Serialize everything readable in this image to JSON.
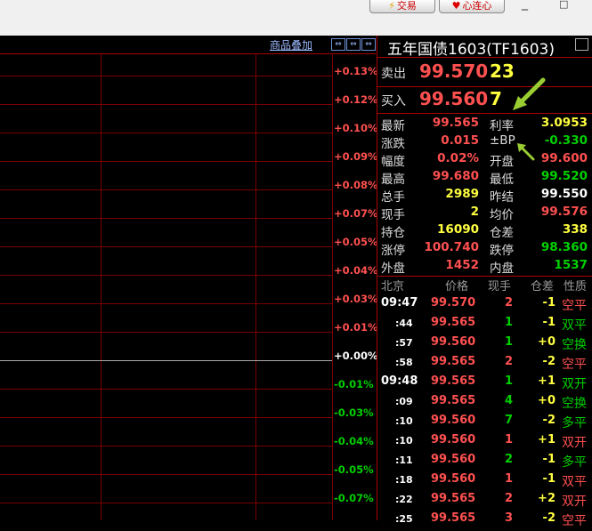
{
  "toolbar": {
    "trade_label": "交易",
    "xinlian_label": "心连心",
    "window_controls": [
      "_",
      "□"
    ]
  },
  "chart": {
    "overlay_link": "商品叠加",
    "zoom_buttons": [
      "⇔",
      "⇔",
      "⇔"
    ],
    "price_labels": [
      "+0.13%",
      "+0.12%",
      "+0.10%",
      "+0.09%",
      "+0.08%",
      "+0.07%",
      "+0.05%",
      "+0.04%",
      "+0.03%",
      "+0.01%",
      "+0.00%",
      "-0.01%",
      "-0.03%",
      "-0.04%",
      "-0.05%",
      "-0.07%"
    ]
  },
  "quote": {
    "title": "五年国债1603(TF1603)",
    "sell_label": "卖出",
    "sell_price": "99.570",
    "sell_vol": "23",
    "buy_label": "买入",
    "buy_price": "99.560",
    "buy_vol": "7",
    "rows": [
      {
        "k": "最新",
        "v": "99.565",
        "vc": "up",
        "k2": "利率",
        "v2": "3.0953",
        "v2c": "yl"
      },
      {
        "k": "涨跌",
        "v": "0.015",
        "vc": "up",
        "k2": "±BP",
        "v2": "-0.330",
        "v2c": "dn"
      },
      {
        "k": "幅度",
        "v": "0.02%",
        "vc": "up",
        "k2": "开盘",
        "v2": "99.600",
        "v2c": "up"
      },
      {
        "k": "最高",
        "v": "99.680",
        "vc": "up",
        "k2": "最低",
        "v2": "99.520",
        "v2c": "dn"
      },
      {
        "k": "总手",
        "v": "2989",
        "vc": "yl",
        "k2": "昨结",
        "v2": "99.550",
        "v2c": "wt"
      },
      {
        "k": "现手",
        "v": "2",
        "vc": "yl",
        "k2": "均价",
        "v2": "99.576",
        "v2c": "up"
      },
      {
        "k": "持仓",
        "v": "16090",
        "vc": "yl",
        "k2": "仓差",
        "v2": "338",
        "v2c": "yl"
      },
      {
        "k": "涨停",
        "v": "100.740",
        "vc": "up",
        "k2": "跌停",
        "v2": "98.360",
        "v2c": "dn"
      },
      {
        "k": "外盘",
        "v": "1452",
        "vc": "up",
        "k2": "内盘",
        "v2": "1537",
        "v2c": "dn"
      }
    ]
  },
  "ticks": {
    "headers": [
      "北京",
      "价格",
      "现手",
      "仓差",
      "性质"
    ],
    "rows": [
      {
        "time": "09:47",
        "price": "99.570",
        "pc": "up",
        "vol": "2",
        "volc": "up",
        "oi": "-1",
        "nature": "空平",
        "nc": "up"
      },
      {
        "time": ":44",
        "price": "99.565",
        "pc": "up",
        "vol": "1",
        "volc": "dn",
        "oi": "-1",
        "nature": "双平",
        "nc": "dn"
      },
      {
        "time": ":57",
        "price": "99.560",
        "pc": "up",
        "vol": "1",
        "volc": "dn",
        "oi": "+0",
        "nature": "空换",
        "nc": "dn"
      },
      {
        "time": ":58",
        "price": "99.565",
        "pc": "up",
        "vol": "2",
        "volc": "up",
        "oi": "-2",
        "nature": "空平",
        "nc": "up"
      },
      {
        "time": "09:48",
        "price": "99.565",
        "pc": "up",
        "vol": "1",
        "volc": "dn",
        "oi": "+1",
        "nature": "双开",
        "nc": "dn"
      },
      {
        "time": ":09",
        "price": "99.565",
        "pc": "up",
        "vol": "4",
        "volc": "dn",
        "oi": "+0",
        "nature": "空换",
        "nc": "dn"
      },
      {
        "time": ":10",
        "price": "99.560",
        "pc": "up",
        "vol": "7",
        "volc": "dn",
        "oi": "-2",
        "nature": "多平",
        "nc": "dn"
      },
      {
        "time": ":10",
        "price": "99.560",
        "pc": "up",
        "vol": "1",
        "volc": "up",
        "oi": "+1",
        "nature": "双开",
        "nc": "up"
      },
      {
        "time": ":11",
        "price": "99.560",
        "pc": "up",
        "vol": "2",
        "volc": "dn",
        "oi": "-1",
        "nature": "多平",
        "nc": "dn"
      },
      {
        "time": ":18",
        "price": "99.560",
        "pc": "up",
        "vol": "1",
        "volc": "up",
        "oi": "-1",
        "nature": "双平",
        "nc": "up"
      },
      {
        "time": ":22",
        "price": "99.565",
        "pc": "up",
        "vol": "2",
        "volc": "up",
        "oi": "+2",
        "nature": "双开",
        "nc": "up"
      },
      {
        "time": ":25",
        "price": "99.565",
        "pc": "up",
        "vol": "3",
        "volc": "up",
        "oi": "-2",
        "nature": "空平",
        "nc": "up"
      }
    ]
  },
  "colors": {
    "up": "#ff5050",
    "down": "#00d000",
    "grid": "#7a0000",
    "frame": "#aa0000",
    "arrow": "#9acd32"
  }
}
